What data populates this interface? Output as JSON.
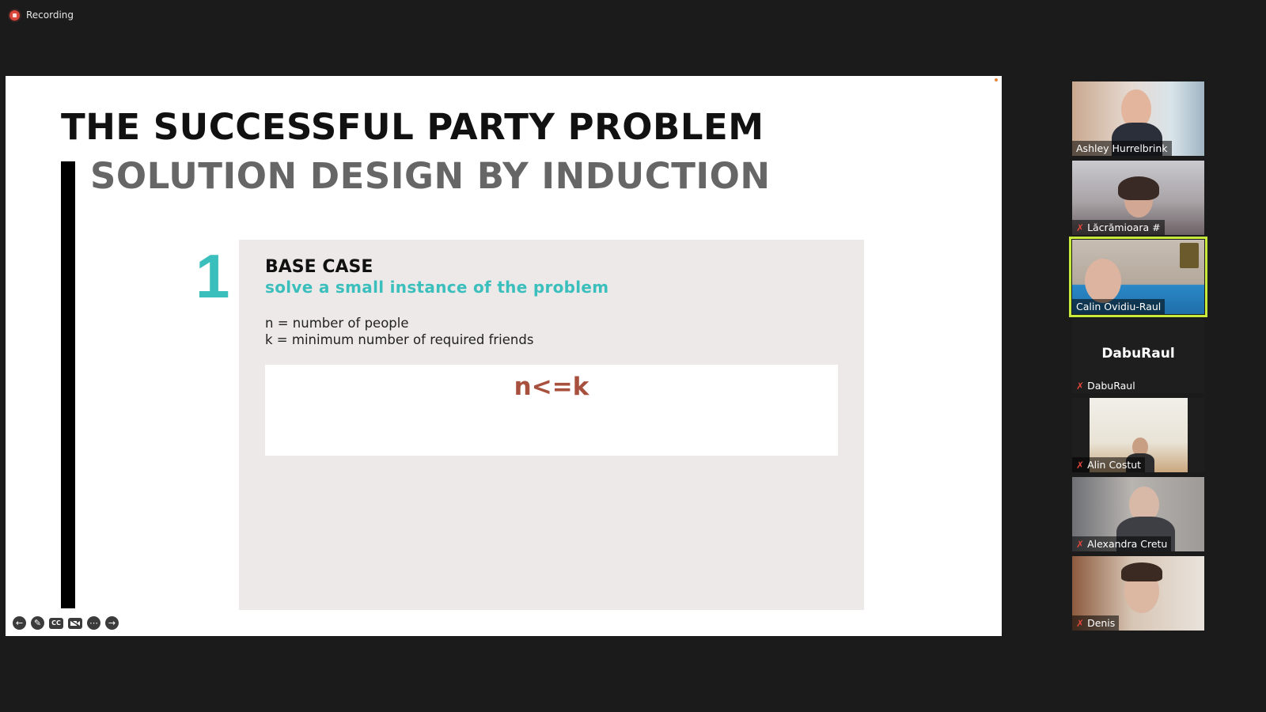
{
  "recording": {
    "label": "Recording"
  },
  "slide": {
    "title": "THE SUCCESSFUL PARTY PROBLEM",
    "subtitle": "SOLUTION DESIGN BY INDUCTION",
    "step_number": "1",
    "heading": "BASE CASE",
    "tagline": "solve a small instance of the problem",
    "definitions": [
      "n = number of people",
      "k = minimum number of required friends"
    ],
    "formula": "n<=k"
  },
  "toolbar": {
    "items": [
      "back-icon",
      "pencil-icon",
      "captions-icon",
      "video-off-icon",
      "more-icon",
      "forward-icon"
    ],
    "captions_label": "CC"
  },
  "participants": [
    {
      "name": "Ashley Hurrelbrink",
      "muted": false,
      "video": true
    },
    {
      "name": "Lăcrămioara #",
      "muted": true,
      "video": true
    },
    {
      "name": "Calin Ovidiu-Raul",
      "muted": false,
      "video": true,
      "active_speaker": true
    },
    {
      "name": "DabuRaul",
      "muted": true,
      "video": false,
      "display": "DabuRaul"
    },
    {
      "name": "Alin Costut",
      "muted": true,
      "video": true
    },
    {
      "name": "Alexandra Cretu",
      "muted": true,
      "video": true
    },
    {
      "name": "Denis",
      "muted": true,
      "video": true
    }
  ],
  "colors": {
    "accent_teal": "#3bbfbd",
    "formula_red": "#a7503e",
    "active_border": "#c8ea3a",
    "muted_red": "#e2463c"
  }
}
